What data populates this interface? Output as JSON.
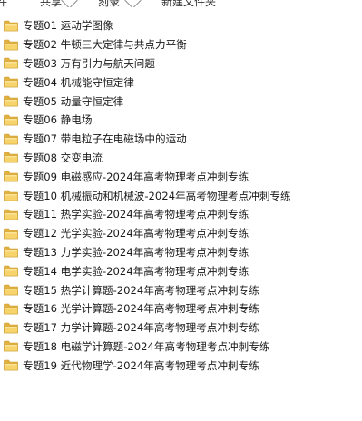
{
  "toolbar": {
    "items": [
      {
        "label": "件"
      },
      {
        "label": "共享"
      },
      {
        "label": "刻录"
      },
      {
        "label": "新建文件夹"
      }
    ]
  },
  "files": [
    {
      "name": "专题01 运动学图像",
      "icon": "folder-icon"
    },
    {
      "name": "专题02 牛顿三大定律与共点力平衡",
      "icon": "folder-icon"
    },
    {
      "name": "专题03  万有引力与航天问题",
      "icon": "folder-icon"
    },
    {
      "name": "专题04  机械能守恒定律",
      "icon": "folder-icon"
    },
    {
      "name": "专题05  动量守恒定律",
      "icon": "folder-icon"
    },
    {
      "name": "专题06  静电场",
      "icon": "folder-icon"
    },
    {
      "name": "专题07 带电粒子在电磁场中的运动",
      "icon": "folder-icon"
    },
    {
      "name": "专题08  交变电流",
      "icon": "folder-icon"
    },
    {
      "name": "专题09  电磁感应-2024年高考物理考点冲刺专练",
      "icon": "folder-icon"
    },
    {
      "name": "专题10  机械振动和机械波-2024年高考物理考点冲刺专练",
      "icon": "folder-icon"
    },
    {
      "name": "专题11 热学实验-2024年高考物理考点冲刺专练",
      "icon": "folder-icon"
    },
    {
      "name": "专题12 光学实验-2024年高考物理考点冲刺专练",
      "icon": "folder-icon"
    },
    {
      "name": "专题13 力学实验-2024年高考物理考点冲刺专练",
      "icon": "folder-icon"
    },
    {
      "name": "专题14 电学实验-2024年高考物理考点冲刺专练",
      "icon": "folder-icon"
    },
    {
      "name": "专题15 热学计算题-2024年高考物理考点冲刺专练",
      "icon": "folder-icon"
    },
    {
      "name": "专题16 光学计算题-2024年高考物理考点冲刺专练",
      "icon": "folder-icon"
    },
    {
      "name": "专题17 力学计算题-2024年高考物理考点冲刺专练",
      "icon": "folder-icon"
    },
    {
      "name": "专题18 电磁学计算题-2024年高考物理考点冲刺专练",
      "icon": "folder-icon"
    },
    {
      "name": "专题19 近代物理学-2024年高考物理考点冲刺专练",
      "icon": "folder-icon"
    }
  ],
  "colors": {
    "folder_front": "#f6d36b",
    "folder_back": "#e2b13f",
    "folder_edge": "#c99a2e"
  }
}
